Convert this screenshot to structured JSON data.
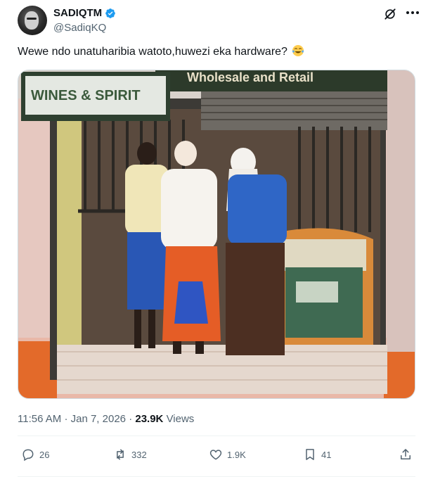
{
  "author": {
    "display_name": "SADIQTM",
    "handle": "@SadiqKQ",
    "verified_color": "#1d9bf0"
  },
  "header_icons": {
    "grok": "grok-icon",
    "more": "more-icon"
  },
  "tweet": {
    "text": "Wewe ndo unatuharibia watoto,huwezi eka hardware?",
    "emoji": "tears-of-joy-emoji"
  },
  "media": {
    "sign_left": "WINES & SPIRIT",
    "sign_top": "Wholesale and Retail"
  },
  "meta": {
    "time": "11:56 AM",
    "separator": "·",
    "date": "Jan 7, 2026",
    "views_count": "23.9K",
    "views_label": "Views"
  },
  "actions": {
    "replies": "26",
    "reposts": "332",
    "likes": "1.9K",
    "bookmarks": "41"
  },
  "colors": {
    "text_primary": "#0f1419",
    "text_secondary": "#536471",
    "accent": "#1d9bf0",
    "divider": "#eff3f4"
  }
}
